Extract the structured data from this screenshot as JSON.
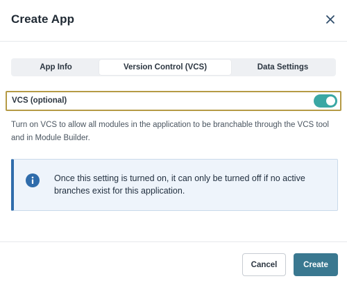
{
  "dialog": {
    "title": "Create App",
    "close_icon": "close-icon"
  },
  "tabs": [
    {
      "label": "App Info",
      "active": false
    },
    {
      "label": "Version Control (VCS)",
      "active": true
    },
    {
      "label": "Data Settings",
      "active": false
    }
  ],
  "vcs": {
    "label": "VCS (optional)",
    "enabled": true,
    "description": "Turn on VCS to allow all modules in the application to be branchable through the VCS tool and in Module Builder."
  },
  "alert": {
    "icon": "info-icon",
    "text": "Once this setting is turned on, it can only be turned off if no active branches exist for this application."
  },
  "footer": {
    "cancel_label": "Cancel",
    "create_label": "Create"
  },
  "colors": {
    "toggle_on": "#3aa7a4",
    "focus_outline": "#b59a45",
    "info_accent": "#2f6cab",
    "info_background": "#eef4fb",
    "primary_button": "#3a7890"
  }
}
